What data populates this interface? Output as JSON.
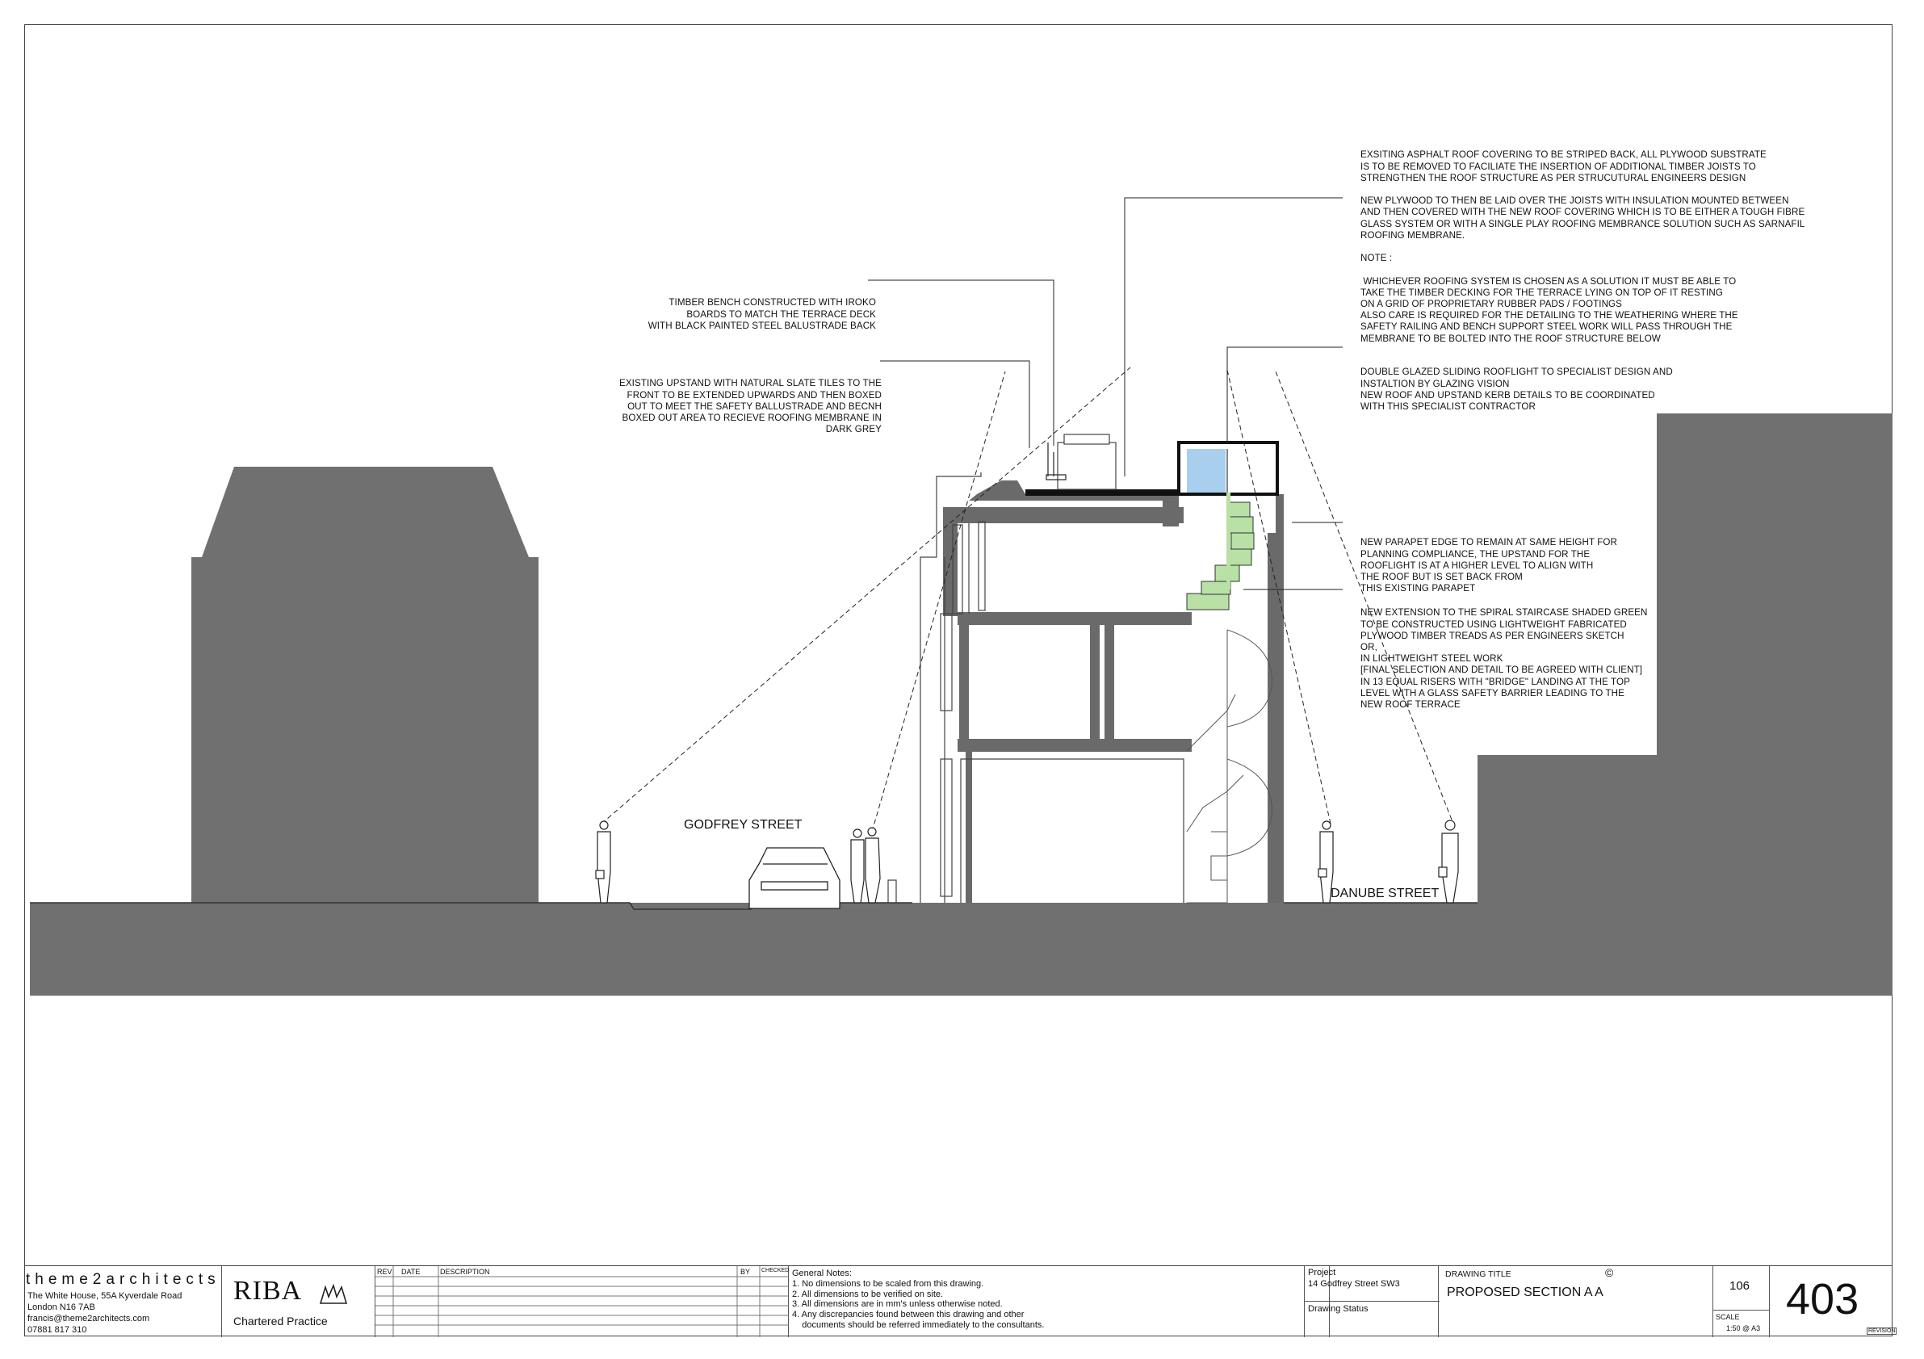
{
  "notes": {
    "roof_covering": [
      "EXSITING ASPHALT ROOF COVERING TO BE STRIPED BACK, ALL PLYWOOD SUBSTRATE",
      "IS TO BE REMOVED TO FACILIATE THE INSERTION OF ADDITIONAL TIMBER JOISTS TO",
      "STRENGTHEN THE ROOF STRUCTURE AS PER STRUCUTURAL ENGINEERS DESIGN",
      "",
      "NEW PLYWOOD TO THEN BE LAID OVER THE JOISTS WITH INSULATION MOUNTED BETWEEN",
      "AND THEN COVERED WITH THE NEW ROOF COVERING WHICH IS TO BE EITHER A TOUGH FIBRE",
      "GLASS SYSTEM OR WITH A SINGLE PLAY ROOFING MEMBRANCE SOLUTION SUCH AS SARNAFIL",
      "ROOFING MEMBRANE.",
      "",
      "NOTE :",
      "",
      " WHICHEVER ROOFING SYSTEM IS CHOSEN AS A SOLUTION IT MUST BE ABLE TO",
      "TAKE THE TIMBER DECKING FOR THE TERRACE LYING ON TOP OF IT RESTING",
      "ON A GRID OF PROPRIETARY RUBBER PADS / FOOTINGS",
      "ALSO CARE IS REQUIRED FOR THE DETAILING TO THE WEATHERING WHERE THE",
      "SAFETY RAILING AND BENCH SUPPORT STEEL WORK WILL PASS THROUGH THE",
      "MEMBRANE TO BE BOLTED INTO THE ROOF STRUCTURE BELOW"
    ],
    "rooflight": [
      "DOUBLE GLAZED SLIDING ROOFLIGHT TO SPECIALIST DESIGN AND",
      "INSTALTION BY GLAZING VISION",
      "NEW ROOF AND UPSTAND KERB DETAILS TO BE COORDINATED",
      "WITH THIS SPECIALIST CONTRACTOR"
    ],
    "bench": [
      "TIMBER BENCH CONSTRUCTED WITH IROKO",
      "BOARDS TO MATCH THE TERRACE DECK",
      "WITH BLACK PAINTED STEEL BALUSTRADE BACK"
    ],
    "upstand": [
      "EXISTING UPSTAND WITH NATURAL SLATE TILES TO THE",
      "FRONT TO BE EXTENDED UPWARDS AND THEN BOXED",
      "OUT TO MEET THE SAFETY BALLUSTRADE AND BECNH",
      "BOXED OUT AREA TO RECIEVE ROOFING MEMBRANE IN",
      "DARK GREY"
    ],
    "parapet": [
      "NEW PARAPET EDGE TO REMAIN AT SAME HEIGHT FOR",
      "PLANNING COMPLIANCE, THE UPSTAND FOR THE",
      "ROOFLIGHT IS AT A HIGHER LEVEL TO ALIGN WITH",
      "THE ROOF BUT IS SET BACK FROM",
      "THIS EXISTING PARAPET"
    ],
    "staircase": [
      "NEW EXTENSION TO THE SPIRAL STAIRCASE SHADED GREEN",
      "TO BE CONSTRUCTED USING LIGHTWEIGHT FABRICATED",
      "PLYWOOD TIMBER TREADS AS PER ENGINEERS SKETCH",
      "OR,",
      "IN LIGHTWEIGHT STEEL WORK",
      "[FINAL SELECTION AND DETAIL TO BE AGREED WITH CLIENT]",
      "IN 13 EQUAL RISERS WITH \"BRIDGE\" LANDING AT THE TOP",
      "LEVEL WITH A GLASS SAFETY BARRIER LEADING TO THE",
      "NEW ROOF TERRACE"
    ]
  },
  "streets": {
    "left": "GODFREY STREET",
    "right": "DANUBE STREET"
  },
  "titleblock": {
    "firm": "theme2architects",
    "address": [
      "The White House, 55A Kyverdale Road",
      "London N16 7AB",
      "francis@theme2architects.com",
      "07881 817 310"
    ],
    "riba": "RIBA",
    "riba_sub": "Chartered Practice",
    "rev_headers": {
      "rev": "REV",
      "date": "DATE",
      "description": "DESCRIPTION",
      "by": "BY",
      "checked": "CHECKED"
    },
    "general_notes": [
      "General Notes:",
      "1. No dimensions to be scaled from this drawing.",
      "2. All dimensions to be verified on site.",
      "3. All dimensions are in mm's unless otherwise noted.",
      "4. Any discrepancies found between this drawing and other",
      "    documents should be referred immediately to the consultants."
    ],
    "project_label": "Project",
    "project": "14 Godfrey Street SW3",
    "status_label": "Drawing Status",
    "drawing_title_label": "DRAWING TITLE",
    "copyright": "©",
    "drawing_title": "PROPOSED SECTION A A",
    "job_number": "106",
    "scale_label": "SCALE",
    "scale": "1:50 @ A3",
    "drawing_number": "403",
    "revision_label": "REVISION"
  },
  "colors": {
    "ground": "#707070",
    "green": "#b9e0a5",
    "glass": "#a9cfee",
    "wall": "#6a6a6a"
  }
}
